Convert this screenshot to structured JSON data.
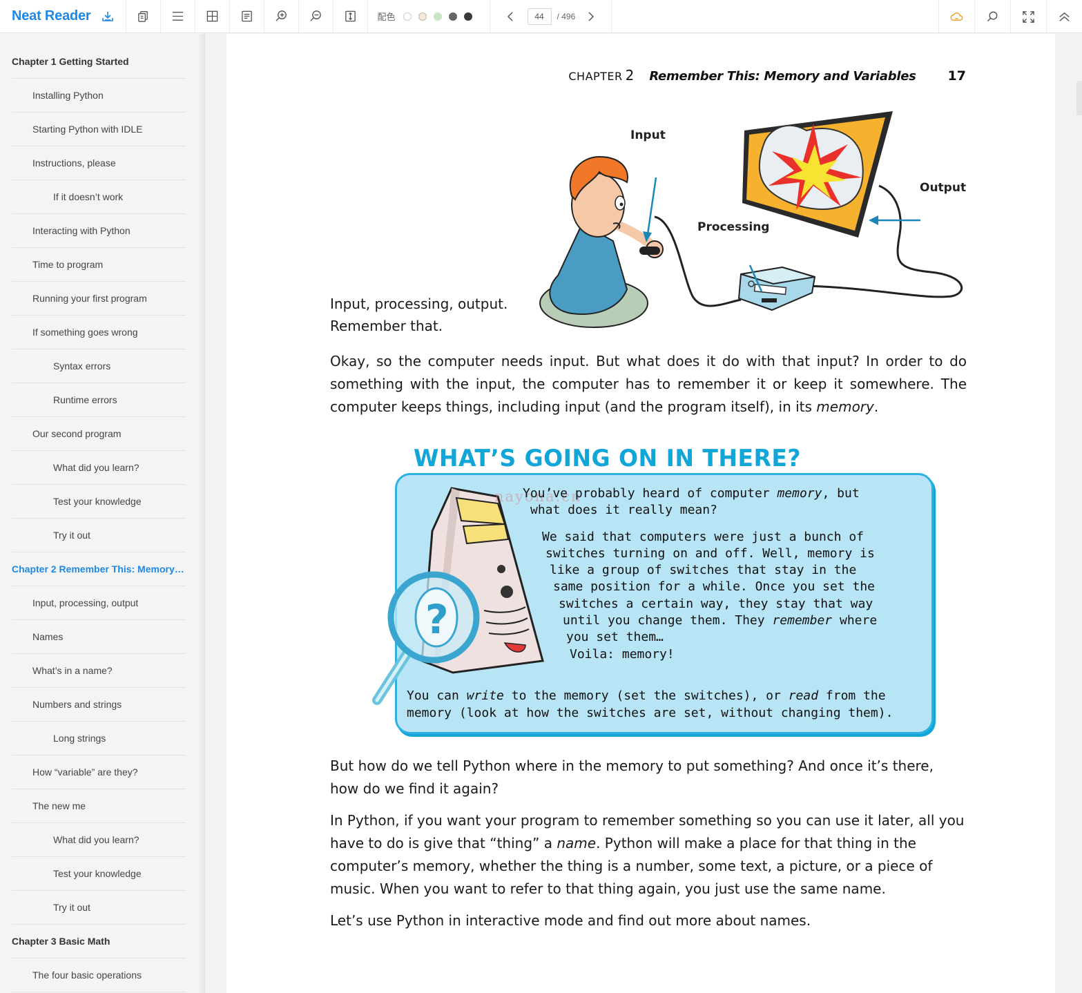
{
  "app": {
    "name": "Neat Reader"
  },
  "toolbar": {
    "color_label": "配色",
    "swatches": [
      "#ffffff",
      "#f3ead9",
      "#c7e6c3",
      "#666666",
      "#3a3a3a"
    ],
    "current_page": "44",
    "total_pages": "/ 496"
  },
  "toc": [
    {
      "label": "Chapter 1 Getting Started",
      "level": 0
    },
    {
      "label": "Installing Python",
      "level": 1
    },
    {
      "label": "Starting Python with IDLE",
      "level": 1
    },
    {
      "label": "Instructions, please",
      "level": 1
    },
    {
      "label": "If it doesn’t work",
      "level": 2
    },
    {
      "label": "Interacting with Python",
      "level": 1
    },
    {
      "label": "Time to program",
      "level": 1
    },
    {
      "label": "Running your first program",
      "level": 1
    },
    {
      "label": "If something goes wrong",
      "level": 1
    },
    {
      "label": "Syntax errors",
      "level": 2
    },
    {
      "label": "Runtime errors",
      "level": 2
    },
    {
      "label": "Our second program",
      "level": 1
    },
    {
      "label": "What did you learn?",
      "level": 2
    },
    {
      "label": "Test your knowledge",
      "level": 2
    },
    {
      "label": "Try it out",
      "level": 2
    },
    {
      "label": "Chapter 2 Remember This: Memory…",
      "level": 0,
      "active": true
    },
    {
      "label": "Input, processing, output",
      "level": 1
    },
    {
      "label": "Names",
      "level": 1
    },
    {
      "label": "What’s in a name?",
      "level": 1
    },
    {
      "label": "Numbers and strings",
      "level": 1
    },
    {
      "label": "Long strings",
      "level": 2
    },
    {
      "label": "How “variable” are they?",
      "level": 1
    },
    {
      "label": "The new me",
      "level": 1
    },
    {
      "label": "What did you learn?",
      "level": 2
    },
    {
      "label": "Test your knowledge",
      "level": 2
    },
    {
      "label": "Try it out",
      "level": 2
    },
    {
      "label": "Chapter 3 Basic Math",
      "level": 0
    },
    {
      "label": "The four basic operations",
      "level": 1
    }
  ],
  "page": {
    "running_head": {
      "chapter_word": "CHAPTER",
      "chapter_num": "2",
      "title": "Remember This: Memory and Variables",
      "page_num": "17"
    },
    "illustration_labels": {
      "input": "Input",
      "processing": "Processing",
      "output": "Output"
    },
    "caption_line1": "Input, processing, output.",
    "caption_line2": "Remember that.",
    "para1_a": "Okay, so the computer needs input. But what does it do with that input? In order to do something with the input, the computer has to remember it or keep it somewhere. The computer keeps things, including input (and the program itself), in its ",
    "para1_em": "memory",
    "para1_b": ".",
    "box_title": "WHAT’S GOING ON IN THERE?",
    "watermark": "nayona.cn",
    "box_lines": [
      {
        "a": "You’ve probably heard of computer ",
        "em": "memory",
        "b": ", but"
      },
      {
        "a": "what does it really mean?",
        "em": "",
        "b": ""
      },
      {
        "a": "We said that computers were just a bunch of",
        "em": "",
        "b": ""
      },
      {
        "a": "switches turning on and off. Well, memory is",
        "em": "",
        "b": ""
      },
      {
        "a": "like a group of switches that stay in the",
        "em": "",
        "b": ""
      },
      {
        "a": "same position for a while. Once you set the",
        "em": "",
        "b": ""
      },
      {
        "a": "switches a certain way, they stay that way",
        "em": "",
        "b": ""
      },
      {
        "a": "until you change them. They ",
        "em": "remember",
        "b": " where"
      },
      {
        "a": "you set them…",
        "em": "",
        "b": ""
      },
      {
        "a": "Voila: memory!",
        "em": "",
        "b": ""
      },
      {
        "a": "You can ",
        "em": "write",
        "b": " to the memory (set the switches), or ",
        "em2": "read",
        "c": " from the"
      },
      {
        "a": "memory (look at how the switches are set, without changing them).",
        "em": "",
        "b": ""
      }
    ],
    "para2": "But how do we tell Python where in the memory to put something? And once it’s there, how do we find it again?",
    "para3_a": "In Python, if you want your program to remember something so you can use it later, all you have to do is give that “thing” a ",
    "para3_em": "name",
    "para3_b": ". Python will make a place for that thing in the computer’s memory, whether the thing is a number, some text, a picture, or a piece of music. When you want to refer to that thing again, you just use the same name.",
    "para4": "Let’s use Python in interactive mode and find out more about names."
  }
}
